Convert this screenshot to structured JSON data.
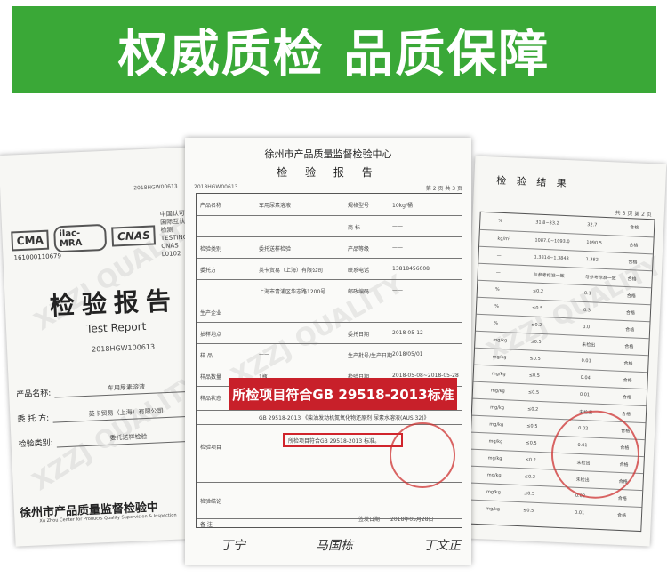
{
  "banner": {
    "title": "权威质检 品质保障"
  },
  "left_doc": {
    "logos": [
      "CMA",
      "ilac-MRA",
      "CNAS"
    ],
    "cert_lines": [
      "中国认可",
      "国际互认",
      "检测",
      "TESTING",
      "CNAS L0102"
    ],
    "cert_no": "161000110679",
    "top_no": "2018HGW00613",
    "title_cn": "检验报告",
    "title_en": "Test Report",
    "report_no": "2018HGW100613",
    "fields": [
      {
        "label": "产品名称:",
        "value": "车用尿素溶液"
      },
      {
        "label": "委 托 方:",
        "value": "英卡贸易（上海）有限公司"
      },
      {
        "label": "检验类别:",
        "value": "委托送样检验"
      }
    ],
    "issuer": "徐州市产品质量监督检验中",
    "issuer_en": "Xu Zhou Center for Products Quality Supervision & Inspection"
  },
  "center_doc": {
    "org": "徐州市产品质量监督检验中心",
    "title": "检 验 报 告",
    "report_no": "2018HGW00613",
    "page": "第 2 页 共 3 页",
    "rows": [
      {
        "label": "产品名称",
        "value": "车用尿素溶液",
        "label2": "规格型号",
        "value2": "10kg/桶"
      },
      {
        "label": "",
        "value": "",
        "label2": "商 标",
        "value2": "——"
      },
      {
        "label": "检验类别",
        "value": "委托送样检验",
        "label2": "产品等级",
        "value2": "——"
      },
      {
        "label": "委托方",
        "value": "英卡贸易（上海）有限公司",
        "label2": "联系电话",
        "value2": "13818456008"
      },
      {
        "label": "",
        "value": "上海市青浦区华志路1200号",
        "label2": "邮政编码",
        "value2": "——"
      },
      {
        "label": "生产企业",
        "value": "",
        "label2": "",
        "value2": ""
      },
      {
        "label": "抽样地点",
        "value": "——",
        "label2": "委托日期",
        "value2": "2018-05-12"
      },
      {
        "label": "样 品",
        "value": "——",
        "label2": "生产批号/生产日期",
        "value2": "2018/05/01"
      },
      {
        "label": "样品数量",
        "value": "1瓶",
        "label2": "检验日期",
        "value2": "2018-05-08~2018-05-28"
      },
      {
        "label": "样品状态",
        "value": "符合检验要求",
        "label2": "",
        "value2": ""
      }
    ],
    "standard": "GB 29518-2013 《柴油发动机氮氧化物还原剂 尿素水溶液(AUS 32)》",
    "item_label": "检验项目",
    "red_callout": "所检项目符合GB 29518-2013标准",
    "conclusion_label": "检验结论",
    "conclusion_text": "所检项目符合GB 29518-2013 标准。",
    "sign_date_label": "签发日期",
    "sign_date": "2018年05月28日",
    "remark_label": "备 注",
    "signatures": [
      "丁宁",
      "马国栋",
      "丁文正"
    ]
  },
  "right_doc": {
    "title": "检 验 结 果",
    "page": "共 3 页 第 2 页",
    "rows": [
      {
        "unit": "%",
        "req": "31.8~33.2",
        "result": "32.7",
        "verdict": "合格"
      },
      {
        "unit": "kg/m³",
        "req": "1087.0~1093.0",
        "result": "1090.5",
        "verdict": "合格"
      },
      {
        "unit": "—",
        "req": "1.3814~1.3843",
        "result": "1.382",
        "verdict": "合格"
      },
      {
        "unit": "—",
        "req": "与参考标准一致",
        "result": "与参考标准一致",
        "verdict": "合格"
      },
      {
        "unit": "%",
        "req": "≤0.2",
        "result": "0.1",
        "verdict": "合格"
      },
      {
        "unit": "%",
        "req": "≤0.5",
        "result": "0.3",
        "verdict": "合格"
      },
      {
        "unit": "%",
        "req": "≤0.2",
        "result": "0.0",
        "verdict": "合格"
      },
      {
        "unit": "mg/kg",
        "req": "≤0.5",
        "result": "未检出",
        "verdict": "合格"
      },
      {
        "unit": "mg/kg",
        "req": "≤0.5",
        "result": "0.01",
        "verdict": "合格"
      },
      {
        "unit": "mg/kg",
        "req": "≤0.5",
        "result": "0.04",
        "verdict": "合格"
      },
      {
        "unit": "mg/kg",
        "req": "≤0.5",
        "result": "0.01",
        "verdict": "合格"
      },
      {
        "unit": "mg/kg",
        "req": "≤0.2",
        "result": "未检出",
        "verdict": "合格"
      },
      {
        "unit": "mg/kg",
        "req": "≤0.5",
        "result": "0.02",
        "verdict": "合格"
      },
      {
        "unit": "mg/kg",
        "req": "≤0.5",
        "result": "0.01",
        "verdict": "合格"
      },
      {
        "unit": "mg/kg",
        "req": "≤0.2",
        "result": "未检出",
        "verdict": "合格"
      },
      {
        "unit": "mg/kg",
        "req": "≤0.2",
        "result": "未检出",
        "verdict": "合格"
      },
      {
        "unit": "mg/kg",
        "req": "≤0.5",
        "result": "0.02",
        "verdict": "合格"
      },
      {
        "unit": "mg/kg",
        "req": "≤0.5",
        "result": "0.01",
        "verdict": "合格"
      }
    ]
  },
  "colors": {
    "banner_green": "#3aa837",
    "callout_red": "#c8202a",
    "highlight_red": "#d0242c"
  }
}
